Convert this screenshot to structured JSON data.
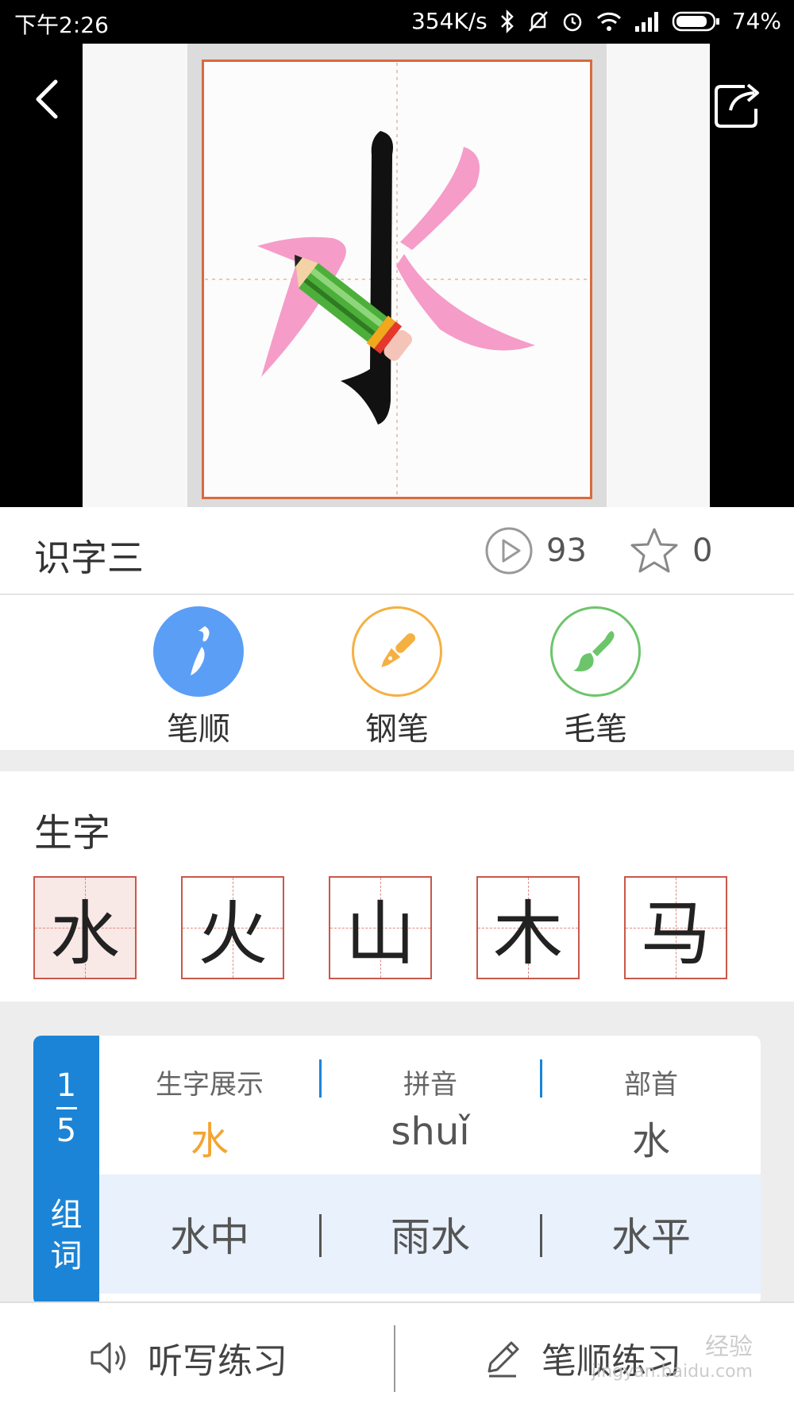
{
  "status_bar": {
    "time": "下午2:26",
    "network_speed": "354K/s",
    "battery": "74%",
    "icons": [
      "bluetooth-icon",
      "bell-muted-icon",
      "alarm-icon",
      "wifi-icon",
      "signal-icon",
      "battery-icon"
    ]
  },
  "video": {
    "character": "水",
    "icons": [
      "back-icon",
      "share-icon",
      "pencil-icon"
    ]
  },
  "lesson": {
    "title": "识字三",
    "play_count": "93",
    "favorite_count": "0"
  },
  "modes": [
    {
      "label": "笔顺",
      "icon": "stroke-order-icon",
      "color": "#5b9ef5",
      "selected": true
    },
    {
      "label": "钢笔",
      "icon": "fountain-pen-icon",
      "color": "#f5b042",
      "selected": false
    },
    {
      "label": "毛笔",
      "icon": "brush-icon",
      "color": "#6cc56a",
      "selected": false
    }
  ],
  "characters_section": {
    "heading": "生字",
    "items": [
      "水",
      "火",
      "山",
      "木",
      "马"
    ],
    "selected_index": 0
  },
  "detail": {
    "index": "1",
    "total": "5",
    "words_label_1": "组",
    "words_label_2": "词",
    "display_label": "生字展示",
    "display_value": "水",
    "pinyin_label": "拼音",
    "pinyin_value": "shuǐ",
    "radical_label": "部首",
    "radical_value": "水",
    "words": [
      "水中",
      "雨水",
      "水平"
    ]
  },
  "bottom_bar": {
    "dictation_label": "听写练习",
    "stroke_practice_label": "笔顺练习"
  },
  "watermark": {
    "text": "经验",
    "sub": "jingyan.baidu.com"
  },
  "colors": {
    "accent_blue": "#1c84d6",
    "orange": "#f4a431",
    "grid_red": "#c9584a"
  }
}
